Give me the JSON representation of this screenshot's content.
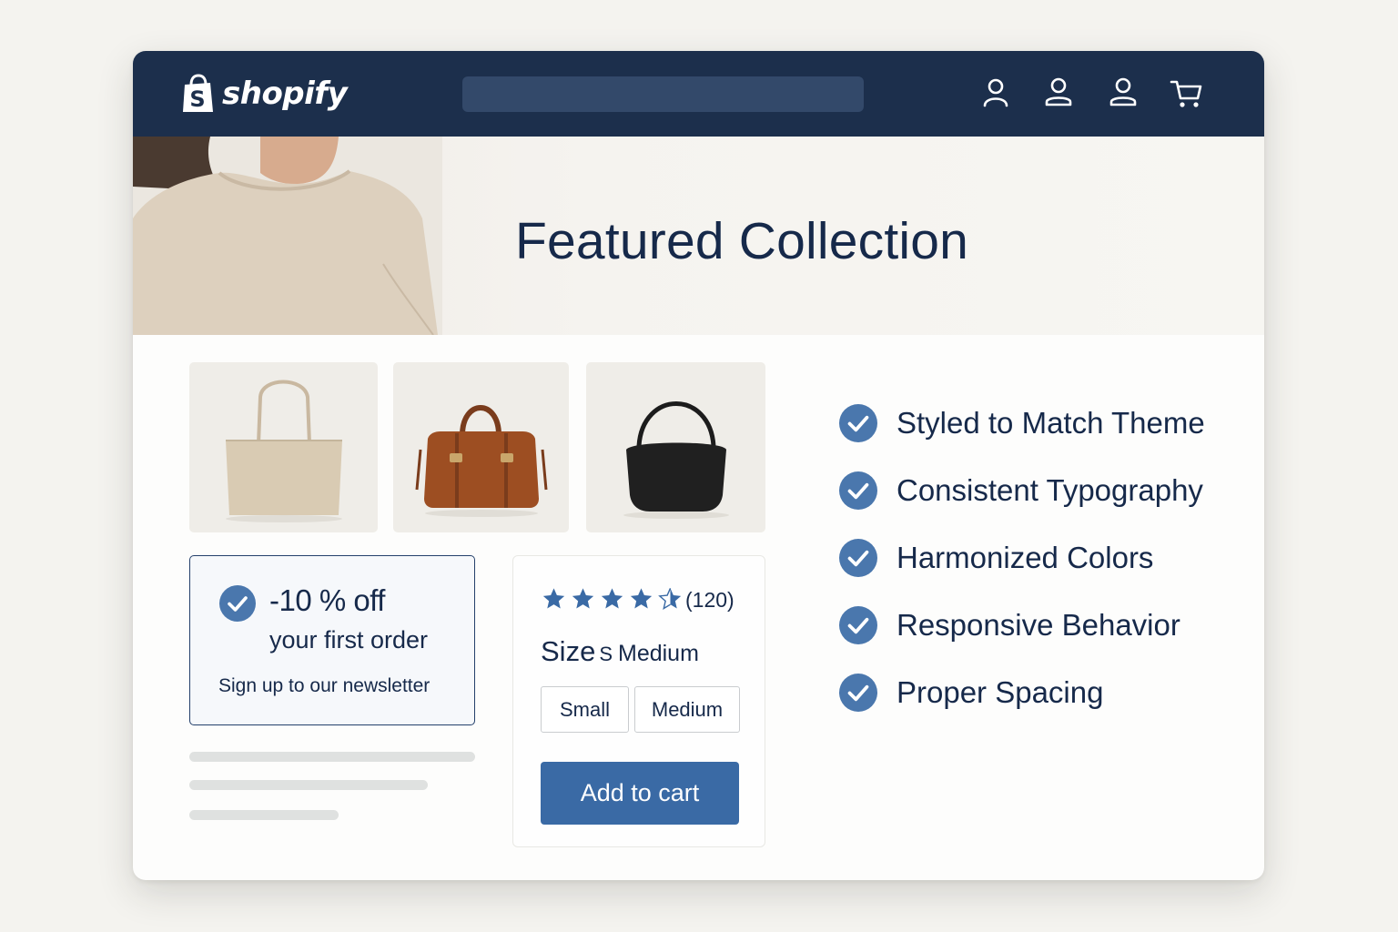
{
  "brand": {
    "name": "shopify"
  },
  "header": {
    "search_placeholder": ""
  },
  "hero": {
    "title": "Featured Collection"
  },
  "products": [
    {
      "icon": "tote-bag-beige"
    },
    {
      "icon": "duffel-bag-brown"
    },
    {
      "icon": "shoulder-bag-black"
    }
  ],
  "promo": {
    "title": "-10 % off",
    "subtitle": "your first order",
    "cta": "Sign up to our newsletter"
  },
  "product_card": {
    "rating": 4.5,
    "rating_max": 5,
    "review_count": "(120)",
    "size_label": "Size",
    "size_letter": "S",
    "size_selected": "Medium",
    "size_options": [
      "Small",
      "Medium"
    ],
    "add_to_cart": "Add to cart"
  },
  "features": [
    "Styled to Match Theme",
    "Consistent Typography",
    "Harmonized Colors",
    "Responsive Behavior",
    "Proper Spacing"
  ],
  "colors": {
    "header_bg": "#1c2f4c",
    "accent_blue": "#3a6aa5",
    "check_blue": "#4a77ad",
    "text_navy": "#16294a"
  }
}
